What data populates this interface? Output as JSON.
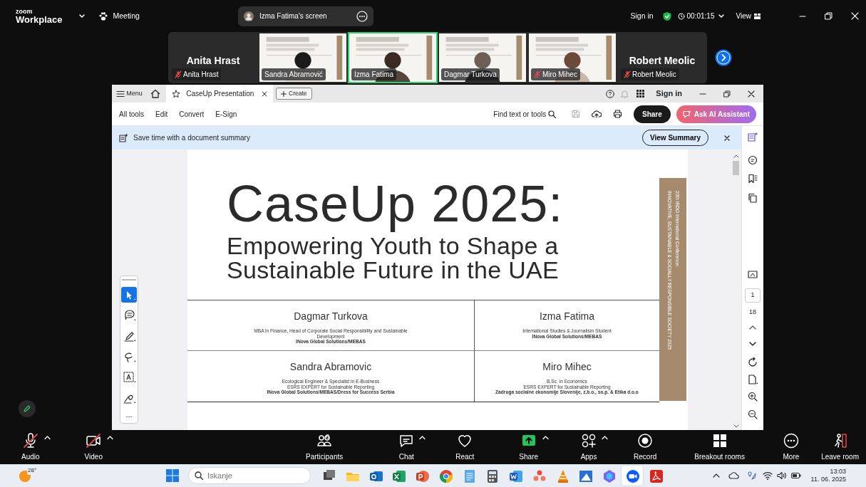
{
  "topbar": {
    "logo_brand": "zoom",
    "logo_product": "Workplace",
    "meeting": "Meeting",
    "share_pill": "Izma Fatima's screen",
    "sign_in": "Sign in",
    "timer": "00:01:15",
    "view": "View"
  },
  "gallery": [
    {
      "kind": "name",
      "name": "Anita Hrast",
      "label": "Anita Hrast",
      "muted": true,
      "selected": false
    },
    {
      "kind": "video",
      "label": "Sandra Abramović",
      "muted": false,
      "selected": false
    },
    {
      "kind": "video",
      "label": "Izma Fatima",
      "muted": false,
      "selected": true
    },
    {
      "kind": "video",
      "label": "Dagmar Turkova",
      "muted": false,
      "selected": false
    },
    {
      "kind": "video",
      "label": "Miro Mihec",
      "muted": true,
      "selected": false
    },
    {
      "kind": "name",
      "name": "Robert Meolic",
      "label": "Robert Meolic",
      "muted": true,
      "selected": false
    }
  ],
  "acrobat": {
    "menu": "Menu",
    "tab": "CaseUp Presentation",
    "create": "Create",
    "sign_in": "Sign in",
    "tools": [
      "All tools",
      "Edit",
      "Convert",
      "E-Sign"
    ],
    "find": "Find text or tools",
    "share": "Share",
    "ai": "Ask AI Assistant",
    "banner": "Save time with a document summary",
    "view_summary": "View Summary",
    "page_current": "1",
    "page_total": "18",
    "palette": [
      {
        "kind": "select",
        "selected": true
      },
      {
        "kind": "comment",
        "selected": false
      },
      {
        "kind": "draw",
        "selected": false
      },
      {
        "kind": "lasso",
        "selected": false
      },
      {
        "kind": "text",
        "selected": false
      },
      {
        "kind": "sign",
        "selected": false
      }
    ],
    "palette_more": "..."
  },
  "slide": {
    "title": "CaseUp 2025:",
    "subtitle_lines": [
      "Empowering Youth to Shape a",
      "Sustainable Future in the UAE"
    ],
    "band_lines": [
      "20th IRDO International Conference:",
      "INNOVATIVE, SUSTAINABLE & SOCIALLY RESPONSIBLE SOCIETY 2025"
    ],
    "people": [
      {
        "name": "Dagmar Turkova",
        "lines": [
          "MBA in Finance, Head of Corporate Social Responsibility and Sustainable Development"
        ],
        "org": "INova Global Solutions/MEBAS"
      },
      {
        "name": "Izma Fatima",
        "lines": [
          "International Studies & Journalism Student"
        ],
        "org": "INova Global Solutions/MEBAS"
      },
      {
        "name": "Sandra Abramovic",
        "lines": [
          "Ecological Engineer & Specialist in E-Business",
          "ESRS EXPERT for Sustainable Reporting"
        ],
        "org": "INova Global Solutions/MEBAS/Dress for Success Serbia"
      },
      {
        "name": "Miro Mihec",
        "lines": [
          "B.Sc. in Economics",
          "ESRS EXPERT for Sustainable Reporting"
        ],
        "org": "Zadruga socialne ekonomije Slovenije, z.b.o., so.p. & Etika d.o.o"
      }
    ]
  },
  "toolbar": [
    {
      "kind": "mic",
      "label": "Audio",
      "off": true,
      "caret": true
    },
    {
      "kind": "camera",
      "label": "Video",
      "off": true,
      "caret": true
    },
    {
      "kind": "people",
      "label": "Participants",
      "count": "8",
      "off": false,
      "caret": false
    },
    {
      "kind": "chat",
      "label": "Chat",
      "off": false,
      "caret": true
    },
    {
      "kind": "heart",
      "label": "React",
      "off": false,
      "caret": false
    },
    {
      "kind": "share",
      "label": "Share",
      "off": false,
      "caret": true
    },
    {
      "kind": "apps",
      "label": "Apps",
      "off": false,
      "caret": true
    },
    {
      "kind": "record",
      "label": "Record",
      "off": false,
      "caret": false
    },
    {
      "kind": "breakout",
      "label": "Breakout rooms",
      "off": false,
      "caret": false
    },
    {
      "kind": "more",
      "label": "More",
      "off": false,
      "caret": false
    }
  ],
  "leave": "Leave room",
  "taskbar": {
    "weather": "28°",
    "search_placeholder": "Iskanje",
    "time": "13:03",
    "date": "11. 06. 2025",
    "apps": [
      {
        "kind": "taskview",
        "selected": false
      },
      {
        "kind": "explorer",
        "selected": false
      },
      {
        "kind": "outlook",
        "selected": false
      },
      {
        "kind": "excel",
        "selected": false
      },
      {
        "kind": "powerpoint",
        "selected": false
      },
      {
        "kind": "chrome",
        "selected": false
      },
      {
        "kind": "notepad",
        "selected": false
      },
      {
        "kind": "calculator",
        "selected": false
      },
      {
        "kind": "word",
        "selected": false
      },
      {
        "kind": "dots",
        "selected": false
      },
      {
        "kind": "vlc",
        "selected": false
      },
      {
        "kind": "paint",
        "selected": false
      },
      {
        "kind": "copilot",
        "selected": false
      },
      {
        "kind": "zoom",
        "selected": true
      },
      {
        "kind": "acrobat",
        "selected": false
      }
    ]
  }
}
